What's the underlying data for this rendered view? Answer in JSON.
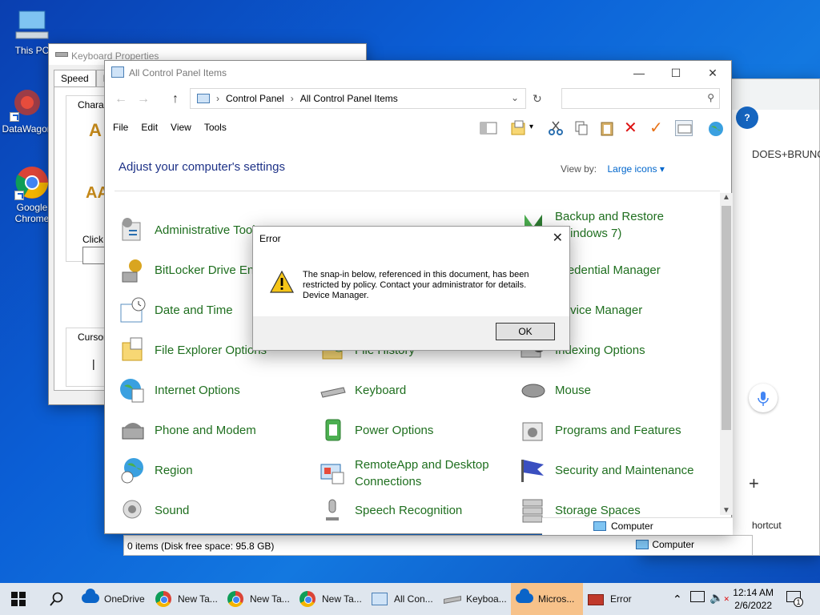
{
  "desktop": {
    "icons": [
      {
        "label": "This PC"
      },
      {
        "label": "DataWagon"
      },
      {
        "label": "Google Chrome"
      }
    ]
  },
  "chrome_bg": {
    "text_fragment": "DOES+BRUNC",
    "shortcut_label": "hortcut",
    "footer_label": "Computer"
  },
  "keyboard_props": {
    "title": "Keyboard Properties",
    "tabs": [
      "Speed",
      "Ha"
    ],
    "groups": {
      "character": "Characte",
      "click": "Click t",
      "cursor": "Cursor bl"
    }
  },
  "control_panel": {
    "title": "All Control Panel Items",
    "breadcrumb": [
      "Control Panel",
      "All Control Panel Items"
    ],
    "menu": [
      "File",
      "Edit",
      "View",
      "Tools"
    ],
    "heading": "Adjust your computer's settings",
    "view_by_label": "View by:",
    "view_by_value": "Large icons",
    "items": [
      {
        "label": "Administrative Tools"
      },
      {
        "label": "Backup and Restore (Windows 7)"
      },
      {
        "label": "BitLocker Drive Encryption"
      },
      {
        "label": "Credential Manager"
      },
      {
        "label": "Date and Time"
      },
      {
        "label": "Device Manager"
      },
      {
        "label": "File Explorer Options"
      },
      {
        "label": "File History"
      },
      {
        "label": "Indexing Options"
      },
      {
        "label": "Internet Options"
      },
      {
        "label": "Keyboard"
      },
      {
        "label": "Mouse"
      },
      {
        "label": "Phone and Modem"
      },
      {
        "label": "Power Options"
      },
      {
        "label": "Programs and Features"
      },
      {
        "label": "Region"
      },
      {
        "label": "RemoteApp and Desktop Connections"
      },
      {
        "label": "Security and Maintenance"
      },
      {
        "label": "Sound"
      },
      {
        "label": "Speech Recognition"
      },
      {
        "label": "Storage Spaces"
      }
    ],
    "inner_status": "Computer"
  },
  "status_bar": {
    "left": "0 items (Disk free space: 95.8 GB)",
    "right": "Computer"
  },
  "error_dialog": {
    "title": "Error",
    "message": "The snap-in below, referenced in this document, has been\nrestricted by policy. Contact your administrator for details.\nDevice Manager.",
    "ok_label": "OK"
  },
  "taskbar": {
    "items": [
      {
        "label": "OneDrive",
        "icon": "onedrive-icon"
      },
      {
        "label": "New Ta...",
        "icon": "chrome-icon"
      },
      {
        "label": "New Ta...",
        "icon": "chrome-icon"
      },
      {
        "label": "New Ta...",
        "icon": "chrome-icon"
      },
      {
        "label": "All Con...",
        "icon": "control-panel-icon"
      },
      {
        "label": "Keyboa...",
        "icon": "keyboard-icon"
      },
      {
        "label": "Micros...",
        "icon": "onedrive-icon",
        "active": true
      },
      {
        "label": "Error",
        "icon": "toolbox-icon"
      }
    ],
    "time": "12:14 AM",
    "date": "2/6/2022",
    "notification_count": "1"
  },
  "colors": {
    "link_green": "#1f6f1f",
    "heading_blue": "#1e3287",
    "taskbar_bg": "#dfe6ee",
    "active_task": "#f7c28a"
  }
}
